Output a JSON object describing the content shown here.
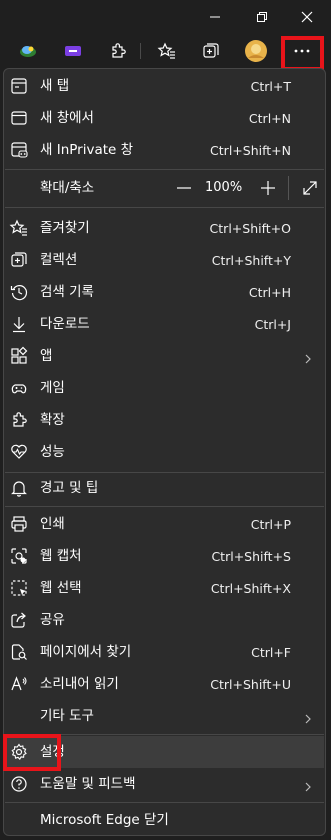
{
  "window_controls": {
    "minimize_icon": "minimize-icon",
    "restore_icon": "restore-icon",
    "close_icon": "close-icon"
  },
  "toolbar": {
    "icons": [
      "extension-icon-globe",
      "extension-icon-purple",
      "extensions-icon",
      "favorites-icon",
      "collections-icon",
      "profile-avatar",
      "more-options-icon"
    ]
  },
  "menu": {
    "new_tab": {
      "label": "새 탭",
      "shortcut": "Ctrl+T"
    },
    "new_window": {
      "label": "새 창에서",
      "shortcut": "Ctrl+N"
    },
    "new_inprivate": {
      "label": "새 InPrivate 창",
      "shortcut": "Ctrl+Shift+N"
    },
    "zoom": {
      "label": "확대/축소",
      "value": "100%"
    },
    "favorites": {
      "label": "즐겨찾기",
      "shortcut": "Ctrl+Shift+O"
    },
    "collections": {
      "label": "컬렉션",
      "shortcut": "Ctrl+Shift+Y"
    },
    "history": {
      "label": "검색 기록",
      "shortcut": "Ctrl+H"
    },
    "downloads": {
      "label": "다운로드",
      "shortcut": "Ctrl+J"
    },
    "apps": {
      "label": "앱"
    },
    "games": {
      "label": "게임"
    },
    "extensions": {
      "label": "확장"
    },
    "performance": {
      "label": "성능"
    },
    "alerts": {
      "label": "경고 및 팁"
    },
    "print": {
      "label": "인쇄",
      "shortcut": "Ctrl+P"
    },
    "web_capture": {
      "label": "웹 캡처",
      "shortcut": "Ctrl+Shift+S"
    },
    "web_select": {
      "label": "웹 선택",
      "shortcut": "Ctrl+Shift+X"
    },
    "share": {
      "label": "공유"
    },
    "find": {
      "label": "페이지에서 찾기",
      "shortcut": "Ctrl+F"
    },
    "read_aloud": {
      "label": "소리내어 읽기",
      "shortcut": "Ctrl+Shift+U"
    },
    "more_tools": {
      "label": "기타 도구"
    },
    "settings": {
      "label": "설정"
    },
    "help": {
      "label": "도움말 및 피드백"
    },
    "close_edge": {
      "label": "Microsoft Edge 닫기"
    }
  },
  "colors": {
    "menu_bg": "#2c2c2c",
    "highlight": "#e8141a",
    "text": "#ffffff"
  }
}
